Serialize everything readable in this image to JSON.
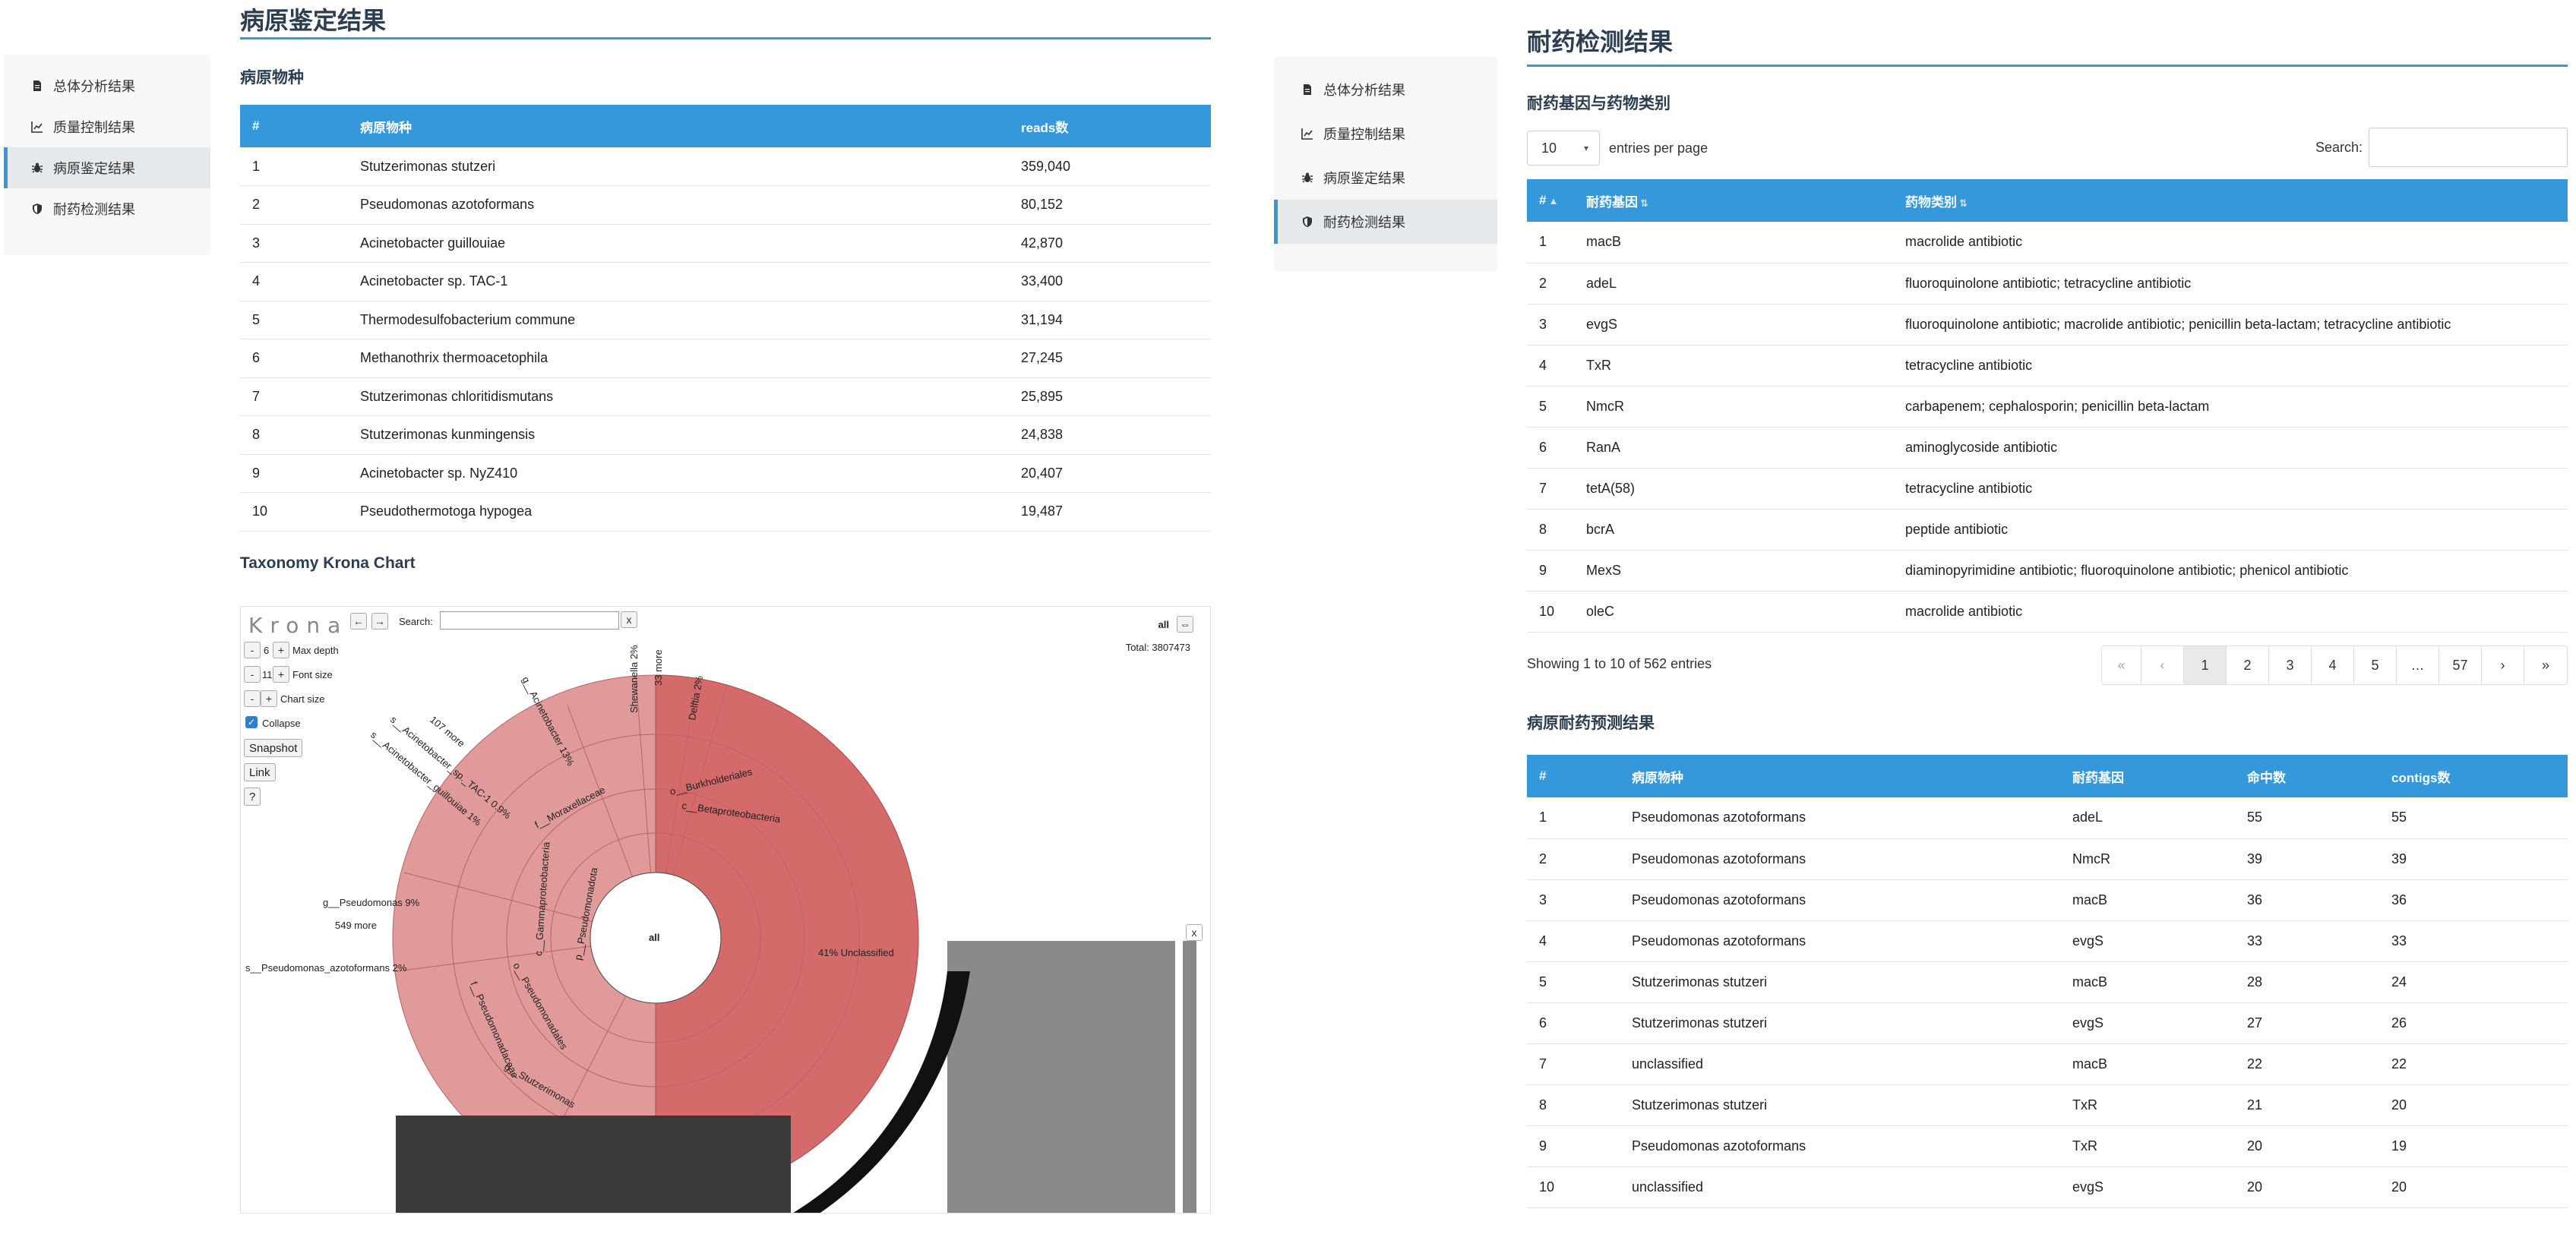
{
  "sidebar": {
    "items": [
      {
        "label": "总体分析结果",
        "icon": "file-icon"
      },
      {
        "label": "质量控制结果",
        "icon": "chart-icon"
      },
      {
        "label": "病原鉴定结果",
        "icon": "bug-icon"
      },
      {
        "label": "耐药检测结果",
        "icon": "shield-icon"
      }
    ]
  },
  "left": {
    "title": "病原鉴定结果",
    "species_section": "病原物种",
    "species_table": {
      "headers": [
        "#",
        "病原物种",
        "reads数"
      ],
      "rows": [
        [
          "1",
          "Stutzerimonas stutzeri",
          "359,040"
        ],
        [
          "2",
          "Pseudomonas azotoformans",
          "80,152"
        ],
        [
          "3",
          "Acinetobacter guillouiae",
          "42,870"
        ],
        [
          "4",
          "Acinetobacter sp. TAC-1",
          "33,400"
        ],
        [
          "5",
          "Thermodesulfobacterium commune",
          "31,194"
        ],
        [
          "6",
          "Methanothrix thermoacetophila",
          "27,245"
        ],
        [
          "7",
          "Stutzerimonas chloritidismutans",
          "25,895"
        ],
        [
          "8",
          "Stutzerimonas kunmingensis",
          "24,838"
        ],
        [
          "9",
          "Acinetobacter sp. NyZ410",
          "20,407"
        ],
        [
          "10",
          "Pseudothermotoga hypogea",
          "19,487"
        ]
      ]
    },
    "krona_section": "Taxonomy Krona Chart",
    "krona": {
      "logo": "Krona",
      "search_label": "Search:",
      "clear": "x",
      "max_depth": "6",
      "max_depth_label": "Max depth",
      "font_size": "11",
      "font_size_label": "Font size",
      "chart_size_label": "Chart size",
      "collapse_label": "Collapse",
      "snapshot": "Snapshot",
      "link": "Link",
      "help": "?",
      "minus": "-",
      "plus": "+",
      "back": "←",
      "forward": "→",
      "all_top": "all",
      "expand": "⇔",
      "total": "Total: 3807473",
      "center": "all",
      "close": "x",
      "labels": {
        "unclassified": "41%   Unclassified",
        "pseudomonas": "g__Pseudomonas   9%",
        "more549": "549 more",
        "azoto": "s__Pseudomonas_azotoformans   2%",
        "acinetobacter": "g__Acinetobacter   13%",
        "more107": "107 more",
        "taca": "s__Acinetobacter_sp._TAC-1   0.9%",
        "guill": "s__Acinetobacter_guillouiae   1%",
        "moraxellaceae": "f__Moraxellaceae",
        "gamma": "c__Gammaproteobacteria",
        "proteo": "p__Pseudomonadota",
        "pseudomonadales": "o__Pseudomonadales",
        "pseudomonadaceae": "f__Pseudomonadaceae",
        "stutzerimonas": "g__Stutzerimonas",
        "burkholderiales": "o__Burkholderiales",
        "beta": "c__Betaproteobacteria",
        "shewanella": "Shewanella   2%",
        "more33": "33 more",
        "delftia": "Delftia   2%"
      }
    }
  },
  "right": {
    "title": "耐药检测结果",
    "genes_section": "耐药基因与药物类别",
    "length_value": "10",
    "length_suffix": "entries per page",
    "search_label": "Search:",
    "genes_table": {
      "headers": [
        "#",
        "耐药基因",
        "药物类别"
      ],
      "rows": [
        [
          "1",
          "macB",
          "macrolide antibiotic"
        ],
        [
          "2",
          "adeL",
          "fluoroquinolone antibiotic; tetracycline antibiotic"
        ],
        [
          "3",
          "evgS",
          "fluoroquinolone antibiotic; macrolide antibiotic; penicillin beta-lactam; tetracycline antibiotic"
        ],
        [
          "4",
          "TxR",
          "tetracycline antibiotic"
        ],
        [
          "5",
          "NmcR",
          "carbapenem; cephalosporin; penicillin beta-lactam"
        ],
        [
          "6",
          "RanA",
          "aminoglycoside antibiotic"
        ],
        [
          "7",
          "tetA(58)",
          "tetracycline antibiotic"
        ],
        [
          "8",
          "bcrA",
          "peptide antibiotic"
        ],
        [
          "9",
          "MexS",
          "diaminopyrimidine antibiotic; fluoroquinolone antibiotic; phenicol antibiotic"
        ],
        [
          "10",
          "oleC",
          "macrolide antibiotic"
        ]
      ]
    },
    "info": "Showing 1 to 10 of 562 entries",
    "pager": [
      "«",
      "‹",
      "1",
      "2",
      "3",
      "4",
      "5",
      "…",
      "57",
      "›",
      "»"
    ],
    "predict_section": "病原耐药预测结果",
    "predict_table": {
      "headers": [
        "#",
        "病原物种",
        "耐药基因",
        "命中数",
        "contigs数"
      ],
      "rows": [
        [
          "1",
          "Pseudomonas azotoformans",
          "adeL",
          "55",
          "55"
        ],
        [
          "2",
          "Pseudomonas azotoformans",
          "NmcR",
          "39",
          "39"
        ],
        [
          "3",
          "Pseudomonas azotoformans",
          "macB",
          "36",
          "36"
        ],
        [
          "4",
          "Pseudomonas azotoformans",
          "evgS",
          "33",
          "33"
        ],
        [
          "5",
          "Stutzerimonas stutzeri",
          "macB",
          "28",
          "24"
        ],
        [
          "6",
          "Stutzerimonas stutzeri",
          "evgS",
          "27",
          "26"
        ],
        [
          "7",
          "unclassified",
          "macB",
          "22",
          "22"
        ],
        [
          "8",
          "Stutzerimonas stutzeri",
          "TxR",
          "21",
          "20"
        ],
        [
          "9",
          "Pseudomonas azotoformans",
          "TxR",
          "20",
          "19"
        ],
        [
          "10",
          "unclassified",
          "evgS",
          "20",
          "20"
        ]
      ]
    }
  },
  "colors": {
    "accent": "#3498db",
    "heading": "#2c3e50",
    "krona_fill": "#d46a6a",
    "krona_light": "#e4a3a3"
  }
}
